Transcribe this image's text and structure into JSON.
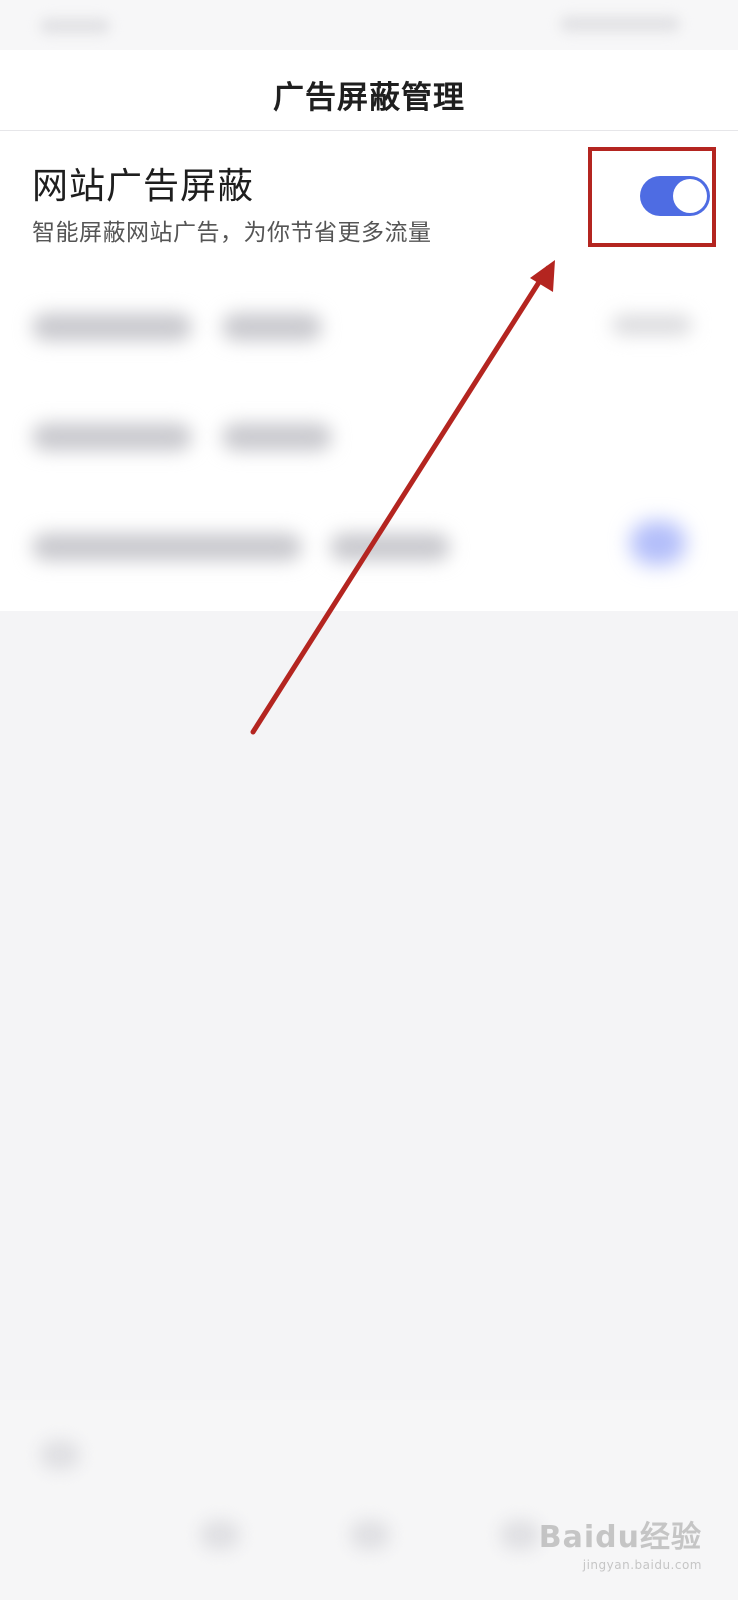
{
  "header": {
    "title": "广告屏蔽管理"
  },
  "setting": {
    "title": "网站广告屏蔽",
    "description": "智能屏蔽网站广告，为你节省更多流量",
    "enabled": true,
    "toggle_color": "#4e6ce3"
  },
  "annotation": {
    "highlight_color": "#b42520",
    "arrow_color": "#b42520"
  },
  "watermark": {
    "logo": "Baidu经验",
    "url": "jingyan.baidu.com"
  }
}
